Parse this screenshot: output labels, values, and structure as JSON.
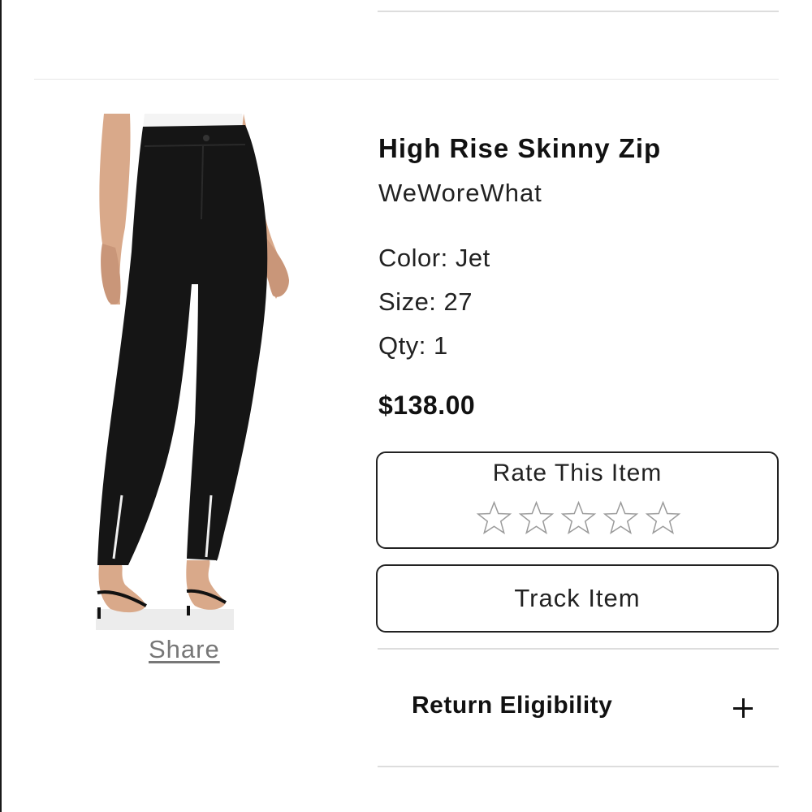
{
  "product": {
    "title": "High Rise Skinny Zip",
    "brand": "WeWoreWhat",
    "color_label": "Color:",
    "color_value": "Jet",
    "size_label": "Size:",
    "size_value": "27",
    "qty_label": "Qty:",
    "qty_value": "1",
    "price": "$138.00",
    "image_icon": "product-photo-black-jeans"
  },
  "share": {
    "label": "Share"
  },
  "rating": {
    "title": "Rate This Item",
    "max_stars": 5,
    "current": 0,
    "star_icon": "star-outline-icon"
  },
  "track": {
    "label": "Track Item"
  },
  "accordion": {
    "label": "Return Eligibility",
    "icon": "plus-icon"
  },
  "colors": {
    "text": "#111111",
    "border": "#222222",
    "divider": "#dddddd",
    "muted_link": "#777777",
    "star_outline": "#9a9a9a"
  }
}
